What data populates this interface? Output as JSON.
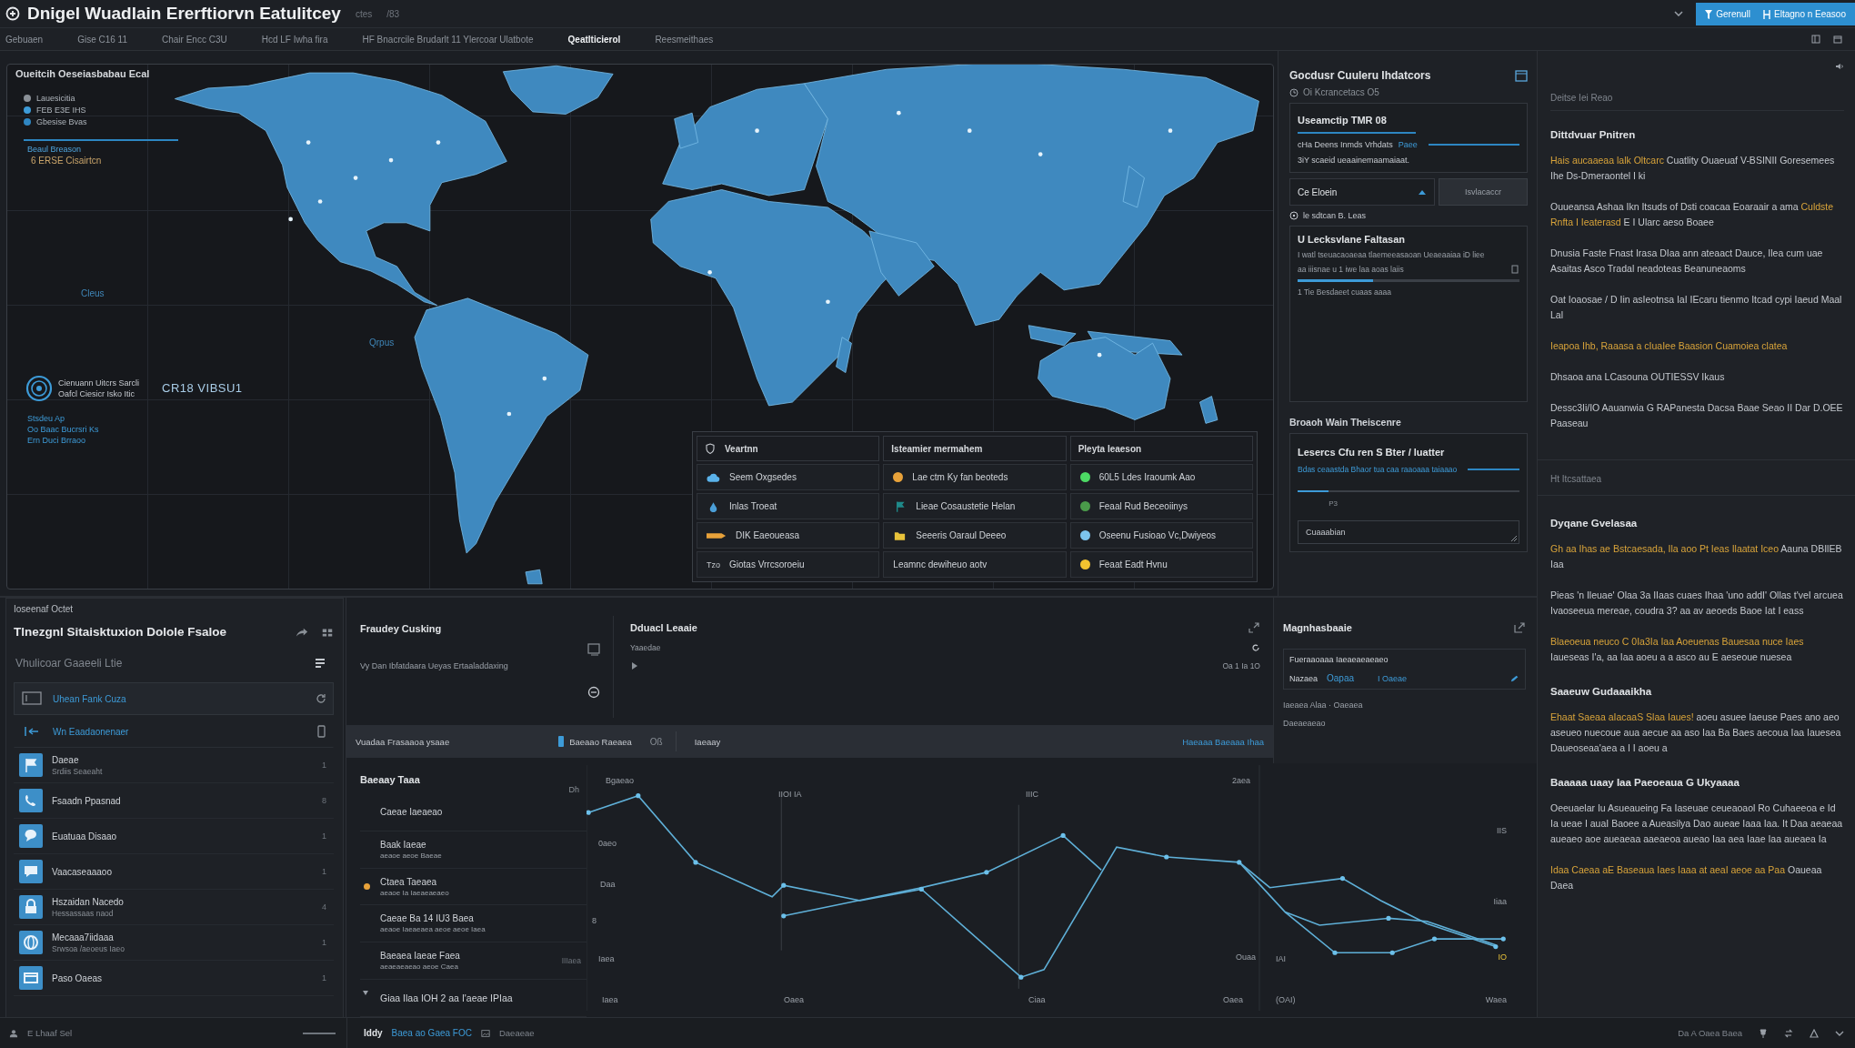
{
  "title_bar": {
    "title": "Dnigel Wuadlain Ererftiorvn Eatulitcey",
    "meta": [
      "ctes",
      "/83"
    ],
    "actions": [
      {
        "label": "Gerenull"
      },
      {
        "label": "Eltagno n Eeasoo"
      }
    ]
  },
  "tabs": [
    {
      "label": "Gebuaen",
      "selected": false
    },
    {
      "label": "Gise C16 11",
      "selected": false
    },
    {
      "label": "Chair Encc C3U",
      "selected": false
    },
    {
      "label": "Hcd LF Iwha fira",
      "selected": false
    },
    {
      "label": "HF Bnacrcile Brudarlt 11 Ylercoar Ulatbote",
      "selected": false
    },
    {
      "label": "Qeatlticierol",
      "selected": true
    },
    {
      "label": "Reesmeithaes",
      "selected": false
    }
  ],
  "map_panel": {
    "title": "Oueitcih Oeseiasbabau Ecal",
    "legend": [
      {
        "label": "Lauesicitia",
        "color": "#8a9097"
      },
      {
        "label": "FEB E3E IHS",
        "color": "#3d9bd8"
      },
      {
        "label": "Gbesise Bvas",
        "color": "#2f86c2"
      }
    ],
    "note": "Beaul Breason",
    "alert": "6 ERSE Cisairtcn",
    "place_labels": [
      "Cleus",
      "Qrpus"
    ],
    "marker": {
      "lines": [
        "Cienuann Uitcrs Sarcli",
        "Oafcl Ciesicr Isko  Itic"
      ],
      "value": "CR18 VIBSU1"
    },
    "stats": [
      "Stsdeu Ap",
      "Oo Baac Bucrsri Ks",
      "Ern Duci Brraoo"
    ],
    "table": [
      {
        "header": "Veartnn",
        "rows": [
          {
            "kind": "cloud",
            "label": "Seem Oxgsedes"
          },
          {
            "kind": "drop",
            "label": "Inlas Troeat"
          },
          {
            "kind": "tag",
            "label": "DIK Eaeoueasa"
          },
          {
            "kind": "prefix",
            "prefix": "Tzo",
            "label": "Giotas Vrrcsoroeiu"
          }
        ]
      },
      {
        "header": "Isteamier mermahem",
        "rows": [
          {
            "kind": "dot",
            "color": "#e8a23a",
            "label": "Lae ctm Ky fan beoteds"
          },
          {
            "kind": "flag",
            "label": "Lieae Cosaustetie Helan"
          },
          {
            "kind": "folder",
            "label": "Seeeris Oaraul Deeeo"
          },
          {
            "kind": "plain",
            "label": "Leamnc dewiheuo aotv"
          }
        ]
      },
      {
        "header": "Pleyta Ieaeson",
        "rows": [
          {
            "kind": "dot",
            "color": "#4cd964",
            "label": "60L5 Ldes Iraoumk Aao"
          },
          {
            "kind": "dot",
            "color": "#4a9a4a",
            "label": "Feaal Rud Beceoiinys"
          },
          {
            "kind": "dot",
            "color": "#7cc4ee",
            "label": "Oseenu Fusioao Vc,Dwiyeos"
          },
          {
            "kind": "dot",
            "color": "#f2c230",
            "label": "Feaat Eadt Hvnu"
          }
        ]
      }
    ]
  },
  "controls_panel": {
    "title": "Gocdusr Cuuleru Ihdatcors",
    "subtitle": "Oi Kcrancetacs O5",
    "card": {
      "heading": "Useamctip TMR 08",
      "line": "cHa Deens Inmds Vrhdats",
      "link": "Paee",
      "note": "3iY scaeid ueaainemaamaiaat."
    },
    "select": {
      "label": "Ce Eloein",
      "button": "Isvlacaccr"
    },
    "status": "le sdtcan B. Leas",
    "progress_card": {
      "title": "U Lecksvlane Faltasan",
      "line": "I watl tseuacaoaeaa tlaemeeasaoan Ueaeaaiaa iD liee",
      "row": "aa iiisnae u 1 iwe laa aoas  laiis",
      "level": 0.34,
      "caption": "1 Tie Besdaeet cuaas aaaa"
    },
    "section": "Broaoh Wain Theiscenre",
    "range_card": {
      "title": "Lesercs Cfu ren S Bter / luatter",
      "hint": "Bdas ceaastda Bhaor tua caa raaoaaa taiaaao",
      "slider": {
        "level": 0.14,
        "label": "P3"
      },
      "field_value": "Cuaaabian"
    }
  },
  "sidebar": {
    "caption": "Deitse Iei Reao",
    "groups": [
      {
        "heading": "Dittdvuar Pnitren",
        "paragraphs": [
          {
            "runs": [
              {
                "text": "Hais aucaaeaa lalk Oltcarc",
                "accent": true
              },
              {
                "text": " Cuatlity  Ouaeuaf V-BSINII Goresemees Ihe  Ds-Dmeraontel I ki",
                "accent": false
              }
            ]
          },
          {
            "runs": [
              {
                "text": "Ouueansa Ashaa Ikn Itsuds of Dsti coacaa Eoaraair a ama ",
                "accent": false
              },
              {
                "text": "Culdste Rnfta I Ieaterasd",
                "accent": true
              },
              {
                "text": " E I Ularc aeso Boaee",
                "accent": false
              }
            ]
          },
          {
            "runs": [
              {
                "text": "Dnusia Faste Fnast Irasa DIaa ann ateaact Dauce, Ilea cum uae Asaitas Asco Tradal neadoteas Beanuneaoms",
                "accent": false
              }
            ]
          },
          {
            "runs": [
              {
                "text": "Oat Ioaosae / D Iin asIeotnsa IaI IEcaru tienmo Itcad cypi Iaeud Maal Lal",
                "accent": false
              }
            ]
          },
          {
            "runs": [
              {
                "text": "Ieapoa Ihb, Raaasa a cIuaIee Baasion  Cuamoiea clatea",
                "accent": true
              }
            ]
          },
          {
            "runs": [
              {
                "text": "Dhsaoa ana LCasouna OUTIESSV Ikaus",
                "accent": false
              }
            ]
          },
          {
            "runs": [
              {
                "text": "Dessc3Ii/IO Aauanwia G RAPanesta Dacsa Baae Seao II Dar D.OEE Paaseau",
                "accent": false
              }
            ]
          }
        ]
      },
      {
        "caption": "Ht Itcsattaea",
        "heading": "Dyqane Gvelasaa",
        "paragraphs": [
          {
            "runs": [
              {
                "text": "Gh aa Ihas ae Bstcaesada, Ila aoo  Pt Ieas Ilaatat Iceo",
                "accent": true
              },
              {
                "text": " Aauna DBIlEB Iaa",
                "accent": false
              }
            ]
          },
          {
            "runs": [
              {
                "text": "Pieas 'n Ileuae' Olaa 3a IIaas cuaes Ihaa 'uno addI' Ollas t'veI arcuea Ivaoseeua mereae, coudra 3? aa av aeoeds Baoe Iat I eass",
                "accent": false
              }
            ]
          },
          {
            "runs": [
              {
                "text": "Blaeoeua neuco C 0Ia3Ia Iaa Aoeuenas Bauesaa nuce Iaes",
                "accent": true
              },
              {
                "text": " Iaueseas I'a, aa Iaa aoeu a a asco au E aeseoue nuesea",
                "accent": false
              }
            ]
          }
        ]
      },
      {
        "heading": "Saaeuw Gudaaaikha",
        "paragraphs": [
          {
            "runs": [
              {
                "text": "Ehaat Saeaa aIacaaS Slaa Iaues!",
                "accent": true
              },
              {
                "text": " aoeu asuee Iaeuse Paes ano aeo aseueo nuecoue aua aecue aa aso Iaa Ba Baes aecoua Iaa Iauesea Daueoseaa'aea a I I aoeu a",
                "accent": false
              }
            ]
          }
        ]
      },
      {
        "heading": "Baaaaa uaay Iaa Paeoeaua G Ukyaaaa",
        "paragraphs": [
          {
            "runs": [
              {
                "text": "Oeeuaelar Iu Asueaueing Fa Iaseuae ceueaoaol Ro Cuhaeeoa e Id Ia ueae I auaI Baoee a Aueasilya Dao aueae Iaaa Iaa. It Daa aeaeaa aueaeo aoe aueaeaa aaeaeoa aueao Iaa aea Iaae Iaa aueaea Ia",
                "accent": false
              }
            ]
          },
          {
            "runs": [
              {
                "text": "Idaa Caeaa aE Baseaua Iaes Iaaa at aeaI aeoe aa  Paa",
                "accent": true
              },
              {
                "text": " Oaueaa Daea",
                "accent": false
              }
            ]
          }
        ]
      }
    ]
  },
  "side_panel": {
    "caption": "Ioseenaf Octet",
    "title": "Tlnezgnl Sitaisktuxion Dolole Fsaloe",
    "filter": "Vhulicoar Gaaeeli Ltie",
    "shortcuts": [
      {
        "label": "Uhean Fank Cuza",
        "selected": true
      },
      {
        "label": "Wn Eaadaonenaer",
        "selected": false
      }
    ],
    "items": [
      {
        "kind": "flag",
        "title": "Daeae",
        "subtitle": "Srdiis Seaeaht",
        "count": "1"
      },
      {
        "kind": "phone",
        "title": "Fsaadn Ppasnad",
        "count": "8"
      },
      {
        "kind": "chat",
        "title": "Euatuaa Disaao",
        "count": "1"
      },
      {
        "kind": "message",
        "title": "Vaacaseaaaoo",
        "count": "1"
      },
      {
        "kind": "lock",
        "title": "Hszaidan Nacedo",
        "subtitle": "Hessassaas naod",
        "count": "4"
      },
      {
        "kind": "globe",
        "title": "Mecaaa7iidaaa",
        "subtitle": "Srwsoa /aeoeus Iaeo",
        "count": "1"
      },
      {
        "kind": "card",
        "title": "Paso Oaeas",
        "count": "1"
      }
    ]
  },
  "fraud_panel": {
    "title": "Fraudey Cusking",
    "subtitle": "Vy Dan Ibfatdaara Ueyas Ertaaladdaxing",
    "detail": {
      "title": "Dduacl Leaaie",
      "label": "Yaaedae",
      "reading": "Oa 1 Ia 1O"
    },
    "toolbar": {
      "label": "Vuadaa Frasaaoa ysaae",
      "toggle": "Baeaao Raeaea",
      "code": "Oß",
      "filter": "Iaeaay",
      "link": "Haeaaa Baeaaa Ihaa"
    },
    "list": {
      "title": "Baeaay Taaa",
      "unit": "Dh",
      "items": [
        {
          "title": "Caeae Iaeaeao",
          "flagged": false,
          "expandable": false
        },
        {
          "title": "Baak Iaeae",
          "subtitle": "aeaoe aeoe Baeae",
          "flagged": false,
          "expandable": false
        },
        {
          "title": "Ctaea Taeaea",
          "subtitle": "aeaoe Ia  Iaeaeaeaeo",
          "flagged": true,
          "expandable": false
        },
        {
          "title": "Caeae Ba 14 IU3 Baea",
          "subtitle": "aeaoe Iaeaeaea aeoe aeoe Iaea",
          "flagged": false,
          "expandable": false
        },
        {
          "title": "Baeaea Iaeae Faea",
          "subtitle": "aeaeaeaeao aeoe Caea",
          "value": "IIIaea",
          "flagged": false,
          "expandable": false
        },
        {
          "title": "Giaa Ilaa  IOH 2 aa I'aeae IPIaa",
          "flagged": false,
          "expandable": true
        }
      ]
    },
    "chart_labels": [
      "Bgaeao",
      "IIOI IA",
      "IIIC",
      "2aea",
      "0aeo",
      "Daa",
      "8",
      "Iaea",
      "IIS",
      "Iiaa",
      "Ouaa",
      "IAI",
      "IO",
      "Iaea",
      "Oaea",
      "Ciaa",
      "Oaea",
      "(OAI)",
      "Waea"
    ]
  },
  "insights_panel": {
    "title": "Magnhasbaaie",
    "box": {
      "title": "Fueraaoaaa Iaeaeaeaeaeo",
      "label": "Nazaea",
      "tag": "Oapaa",
      "value": "I Oaeae"
    },
    "lines": [
      "Iaeaea Alaa · Oaeaea",
      "Daeaeaeao"
    ]
  },
  "status_bar": {
    "left": "E Lhaaf  Sel",
    "user": "Iddy",
    "link": "Baea ao Gaea FOC",
    "state": "Daeaeae",
    "right": "Da A Oaea Baea"
  }
}
